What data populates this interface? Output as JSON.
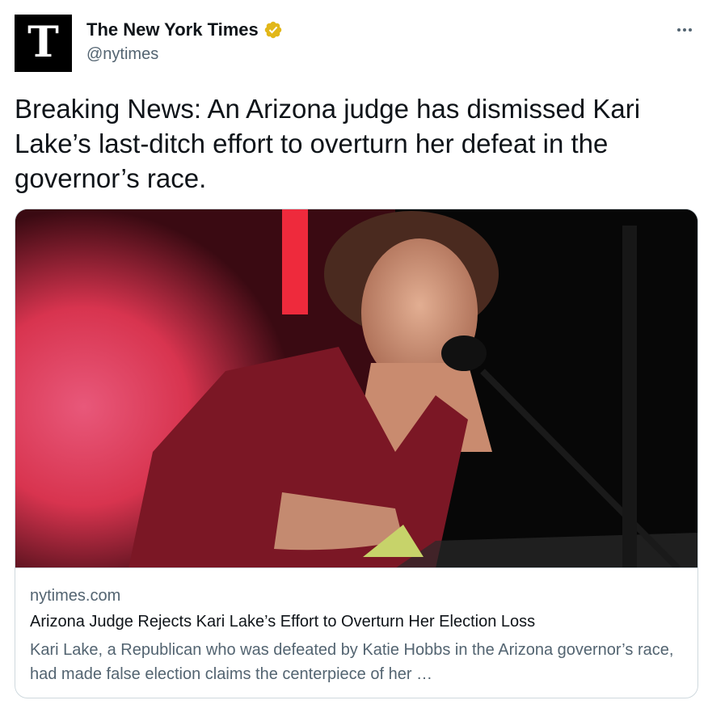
{
  "author": {
    "name": "The New York Times",
    "handle": "@nytimes",
    "avatar_glyph": "T",
    "verified": true,
    "verified_color": "#e2b719"
  },
  "menu_icon": "more-horizontal-icon",
  "tweet": {
    "text": "Breaking News: An Arizona judge has dismissed Kari Lake’s last-ditch effort to overturn her defeat in the governor’s race."
  },
  "link_card": {
    "domain": "nytimes.com",
    "title": "Arizona Judge Rejects Kari Lake’s Effort to Overturn Her Election Loss",
    "description": "Kari Lake, a Republican who was defeated by Katie Hobbs in the Arizona governor’s race, had made false election claims the centerpiece of her …"
  },
  "colors": {
    "text_primary": "#0f1419",
    "text_secondary": "#536471",
    "border": "#cfd9de"
  }
}
